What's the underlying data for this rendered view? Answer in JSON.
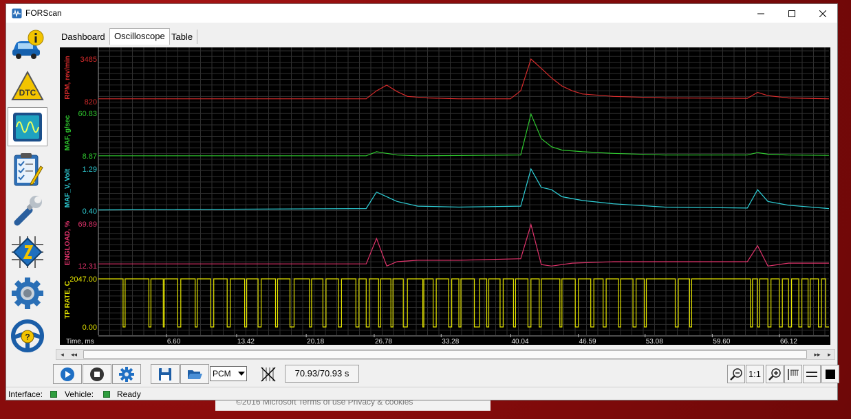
{
  "window": {
    "title": "FORScan"
  },
  "background_text": "©2016 Microsoft    Terms of use    Privacy & cookies",
  "sidebar": {
    "items": [
      {
        "name": "vehicle-info"
      },
      {
        "name": "dtc"
      },
      {
        "name": "oscilloscope"
      },
      {
        "name": "tests"
      },
      {
        "name": "service"
      },
      {
        "name": "configuration"
      },
      {
        "name": "settings"
      },
      {
        "name": "help"
      }
    ]
  },
  "tabs": [
    {
      "label": "Dashboard"
    },
    {
      "label": "Oscilloscope"
    },
    {
      "label": "Table"
    }
  ],
  "active_tab": "Oscilloscope",
  "colors": {
    "rpm": "#d42b2b",
    "maf": "#2fc92f",
    "maf_v": "#2fd0d8",
    "engload": "#e0336b",
    "tp_rate": "#e6e600",
    "axis_text": "#e8e8e8"
  },
  "chart_data": {
    "type": "line",
    "xlabel": "Time, ms",
    "xticks": [
      "6.60",
      "13.42",
      "20.18",
      "26.78",
      "33.28",
      "40.04",
      "46.59",
      "53.08",
      "59.60",
      "66.12"
    ],
    "xrange": [
      0,
      70.93
    ],
    "channels": [
      {
        "name": "RPM, rev/min",
        "max_label": "3485",
        "min_label": "820",
        "range": [
          820,
          3485
        ],
        "points": [
          [
            0,
            1000
          ],
          [
            26,
            1000
          ],
          [
            27,
            1500
          ],
          [
            28,
            1850
          ],
          [
            29,
            1450
          ],
          [
            30,
            1150
          ],
          [
            32,
            1050
          ],
          [
            35,
            1000
          ],
          [
            40,
            1000
          ],
          [
            41,
            1500
          ],
          [
            42,
            3485
          ],
          [
            43,
            2900
          ],
          [
            44,
            2300
          ],
          [
            45,
            1800
          ],
          [
            46,
            1500
          ],
          [
            47,
            1300
          ],
          [
            50,
            1150
          ],
          [
            55,
            1050
          ],
          [
            63,
            1030
          ],
          [
            64,
            1400
          ],
          [
            65,
            1200
          ],
          [
            67,
            1050
          ],
          [
            70.93,
            1000
          ]
        ]
      },
      {
        "name": "MAF, g/sec",
        "max_label": "60.83",
        "min_label": "8.87",
        "range": [
          8.87,
          60.83
        ],
        "points": [
          [
            0,
            9
          ],
          [
            26,
            9
          ],
          [
            27,
            14
          ],
          [
            28,
            12
          ],
          [
            29,
            10
          ],
          [
            31,
            9
          ],
          [
            41,
            10
          ],
          [
            42,
            60
          ],
          [
            43,
            30
          ],
          [
            44,
            20
          ],
          [
            45,
            16
          ],
          [
            47,
            14
          ],
          [
            50,
            12
          ],
          [
            55,
            10
          ],
          [
            63,
            10
          ],
          [
            64,
            13
          ],
          [
            65,
            11
          ],
          [
            67,
            10
          ],
          [
            70.93,
            9.5
          ]
        ]
      },
      {
        "name": "MAF_V, Volt",
        "max_label": "1.29",
        "min_label": "0.40",
        "range": [
          0.4,
          1.29
        ],
        "points": [
          [
            0,
            0.42
          ],
          [
            26,
            0.45
          ],
          [
            27,
            0.8
          ],
          [
            28,
            0.7
          ],
          [
            29,
            0.6
          ],
          [
            30,
            0.55
          ],
          [
            31,
            0.5
          ],
          [
            35,
            0.48
          ],
          [
            41,
            0.5
          ],
          [
            42,
            1.29
          ],
          [
            43,
            0.9
          ],
          [
            44,
            0.85
          ],
          [
            45,
            0.7
          ],
          [
            47,
            0.62
          ],
          [
            50,
            0.55
          ],
          [
            55,
            0.48
          ],
          [
            63,
            0.46
          ],
          [
            64,
            0.85
          ],
          [
            65,
            0.6
          ],
          [
            67,
            0.52
          ],
          [
            70.93,
            0.45
          ]
        ]
      },
      {
        "name": "ENGLOAD, %",
        "max_label": "69.89",
        "min_label": "12.31",
        "range": [
          12.31,
          69.89
        ],
        "points": [
          [
            0,
            15
          ],
          [
            26,
            15
          ],
          [
            27,
            50
          ],
          [
            28,
            12
          ],
          [
            29,
            18
          ],
          [
            31,
            20
          ],
          [
            35,
            20
          ],
          [
            41,
            22
          ],
          [
            42,
            69
          ],
          [
            43,
            14
          ],
          [
            44,
            12
          ],
          [
            46,
            16
          ],
          [
            50,
            18
          ],
          [
            55,
            18
          ],
          [
            63,
            18
          ],
          [
            64,
            40
          ],
          [
            65,
            12
          ],
          [
            67,
            16
          ],
          [
            70.93,
            16
          ]
        ]
      },
      {
        "name": "TP RATE, C",
        "max_label": "2047.00",
        "min_label": "0.00",
        "range": [
          0,
          2047
        ],
        "toggles": [
          0,
          2.4,
          2.6,
          4.9,
          5.1,
          6.3,
          6.4,
          7.7,
          8.0,
          9.4,
          9.6,
          10.9,
          11.2,
          12.5,
          12.8,
          14.2,
          14.4,
          15.5,
          15.8,
          17.2,
          17.4,
          18.6,
          19.0,
          20.5,
          20.7,
          21.8,
          22.1,
          23.3,
          23.6,
          25.0,
          25.3,
          26.0,
          26.3,
          27.2,
          27.4,
          28.4,
          28.6,
          29.6,
          30.0,
          31.5,
          31.6,
          32.5,
          32.8,
          34.0,
          34.3,
          35.0,
          35.2,
          36.5,
          37.0,
          37.7,
          37.9,
          39.0,
          39.3,
          40.3,
          40.5,
          41.7,
          42.0,
          42.8,
          43.0,
          44.8,
          45.0,
          46.3,
          46.6,
          47.8,
          48.1,
          49.0,
          49.3,
          50.5,
          50.7,
          51.9,
          52.2,
          53.0,
          53.2,
          56.0,
          56.3,
          57.4,
          57.6,
          63.3,
          63.5,
          64.0,
          64.2,
          65.0,
          65.3,
          66.1,
          66.4,
          67.0,
          67.3,
          68.0,
          68.3,
          68.9,
          69.1,
          69.9,
          70.2,
          70.6
        ]
      }
    ]
  },
  "scrollbar": {
    "left_label": "◂",
    "rewind_label": "◂◂",
    "forward_label": "▸▸",
    "right_label": "▸"
  },
  "toolbar": {
    "ecu_select": "PCM",
    "time_display": "70.93/70.93 s",
    "zoom_reset_label": "1:1"
  },
  "status": {
    "interface_label": "Interface:",
    "vehicle_label": "Vehicle:",
    "ready_text": "Ready"
  }
}
